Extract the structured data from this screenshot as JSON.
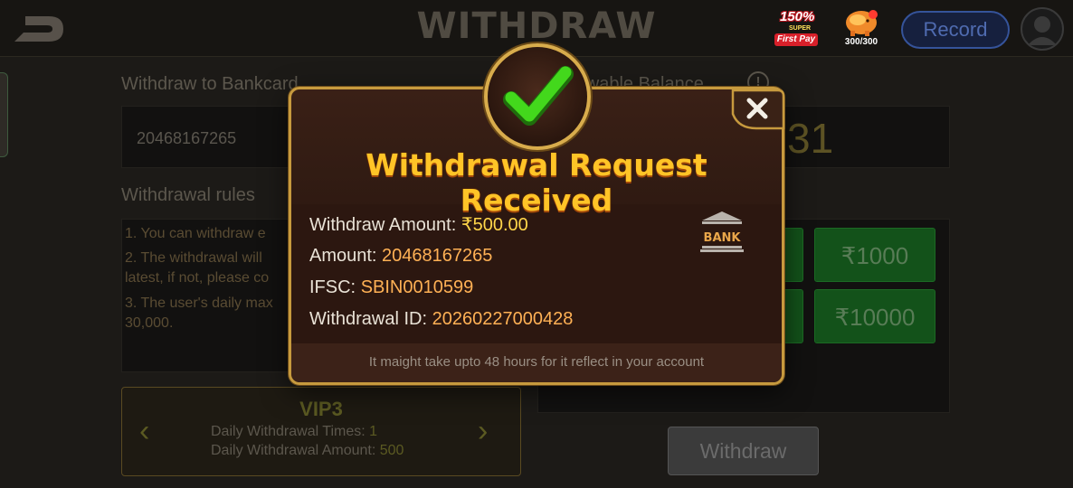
{
  "header": {
    "title": "WITHDRAW",
    "promo_percent": "150%",
    "promo_super": "SUPER",
    "promo_label": "First Pay",
    "piggy_count": "300/300",
    "record_label": "Record"
  },
  "form": {
    "bankcard_label": "Withdraw to Bankcard",
    "bankcard_value": "20468167265",
    "balance_label": "rawable Balance",
    "balance_value": "31",
    "rules_label": "Withdrawal rules",
    "rules": [
      "1. You can withdraw e",
      "2. The withdrawal will",
      "latest, if not, please co",
      "3. The user's daily max",
      "30,000."
    ],
    "amount_buttons": [
      "₹1000",
      "₹10000"
    ],
    "withdraw_label": "Withdraw"
  },
  "vip": {
    "title": "VIP3",
    "times_label": "Daily Withdrawal Times:",
    "times_value": "1",
    "amount_label": "Daily Withdrawal Amount:",
    "amount_value": "500"
  },
  "modal": {
    "title": "Withdrawal Request Received",
    "withdraw_amount_label": "Withdraw Amount:",
    "withdraw_amount_value": "₹500.00",
    "amount_label": "Amount:",
    "amount_value": "20468167265",
    "ifsc_label": "IFSC:",
    "ifsc_value": "SBIN0010599",
    "withdrawal_id_label": "Withdrawal ID:",
    "withdrawal_id_value": "20260227000428",
    "bank_label": "BANK",
    "note": "It maight take upto 48 hours for it reflect in your account"
  },
  "icons": {
    "back": "back-arrow-icon",
    "check": "checkmark-icon",
    "close": "close-icon",
    "bank": "bank-icon",
    "avatar": "user-avatar-icon",
    "piggy": "piggy-bank-icon"
  },
  "colors": {
    "modal_border": "#c79a3e",
    "title_gold": "#ffc427",
    "value_orange": "#ffb155",
    "check_green": "#3fd21a",
    "amount_green": "#13521a"
  }
}
